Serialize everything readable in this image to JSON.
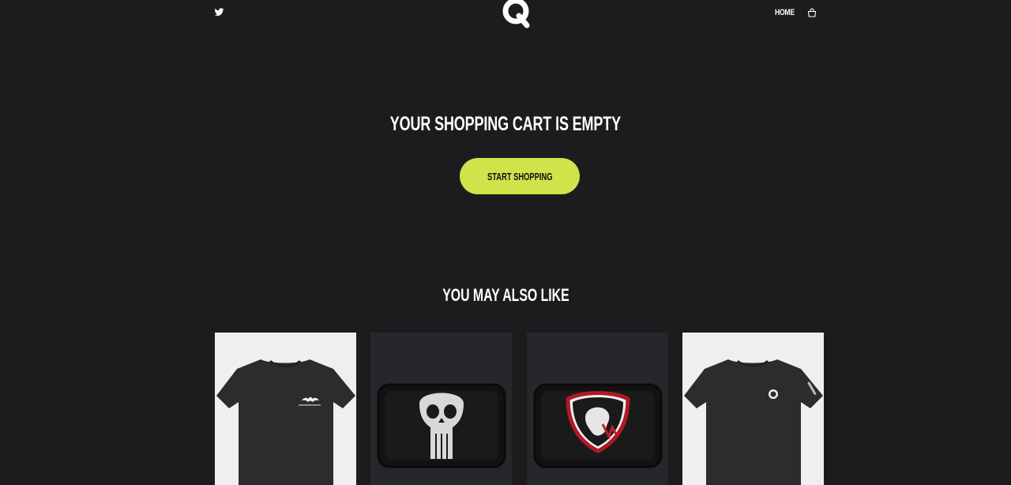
{
  "header": {
    "logo_letter": "Q",
    "nav_home": "HOME"
  },
  "cart": {
    "empty_title": "YOUR SHOPPING CART IS EMPTY",
    "cta_label": "START SHOPPING"
  },
  "recommendations": {
    "title": "YOU MAY ALSO LIKE",
    "products": [
      {
        "icon": "black-tshirt-bat-logo"
      },
      {
        "icon": "skull-patch"
      },
      {
        "icon": "ghost-shield-patch"
      },
      {
        "icon": "black-tshirt-emblem"
      }
    ]
  },
  "colors": {
    "background": "#1c1c1f",
    "accent": "#cfe34a",
    "card_dark": "#26272b",
    "card_light": "#efefef"
  }
}
